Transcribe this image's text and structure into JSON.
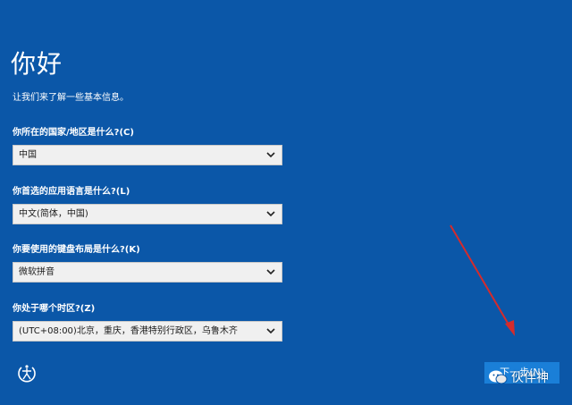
{
  "page": {
    "title": "你好",
    "subtitle": "让我们来了解一些基本信息。"
  },
  "fields": [
    {
      "label": "你所在的国家/地区是什么?(C)",
      "value": "中国"
    },
    {
      "label": "你首选的应用语言是什么?(L)",
      "value": "中文(简体，中国)"
    },
    {
      "label": "你要使用的键盘布局是什么?(K)",
      "value": "微软拼音"
    },
    {
      "label": "你处于哪个时区?(Z)",
      "value": "(UTC+08:00)北京，重庆，香港特别行政区，乌鲁木齐"
    }
  ],
  "footer": {
    "next_label": "下一步(N)",
    "accessibility_icon": "ease-of-access-icon"
  },
  "watermark": {
    "text": "伙伴神",
    "icon": "wechat-icon"
  },
  "colors": {
    "background": "#0b57a8",
    "button": "#1a7fd8",
    "annotation_arrow": "#d62b2b"
  }
}
